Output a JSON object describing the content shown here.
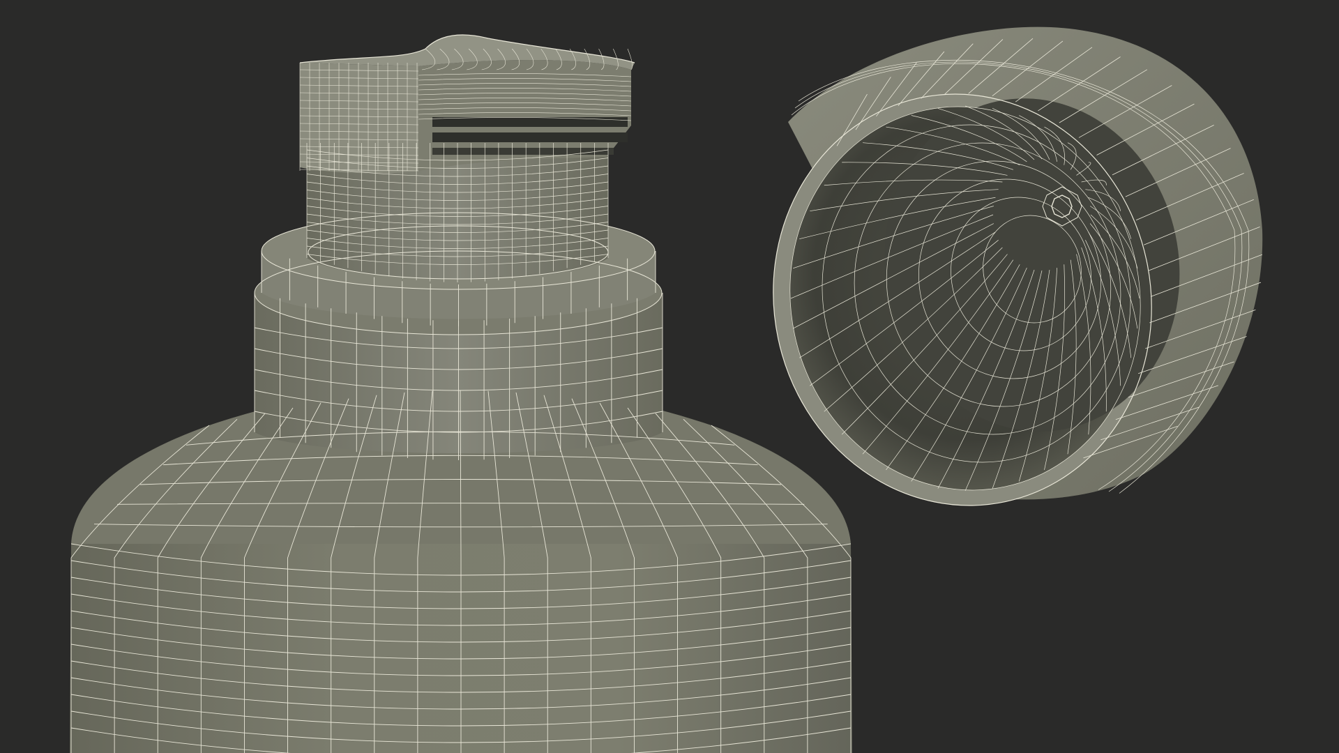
{
  "scene": {
    "background_color": "#2a2a29",
    "surface_color": "#7a7a6c",
    "surface_shadow_color": "#5f5f53",
    "surface_highlight_color": "#8a8a7c",
    "cap_interior_color": "#55564b",
    "cap_interior_deep_color": "#3f403a",
    "wire_color": "#e9e7d8",
    "objects": [
      {
        "name": "bottle-body"
      },
      {
        "name": "bottle-shoulder"
      },
      {
        "name": "bottle-neck-ring"
      },
      {
        "name": "dispenser-stem"
      },
      {
        "name": "dispenser-head"
      },
      {
        "name": "removed-cap"
      }
    ]
  }
}
